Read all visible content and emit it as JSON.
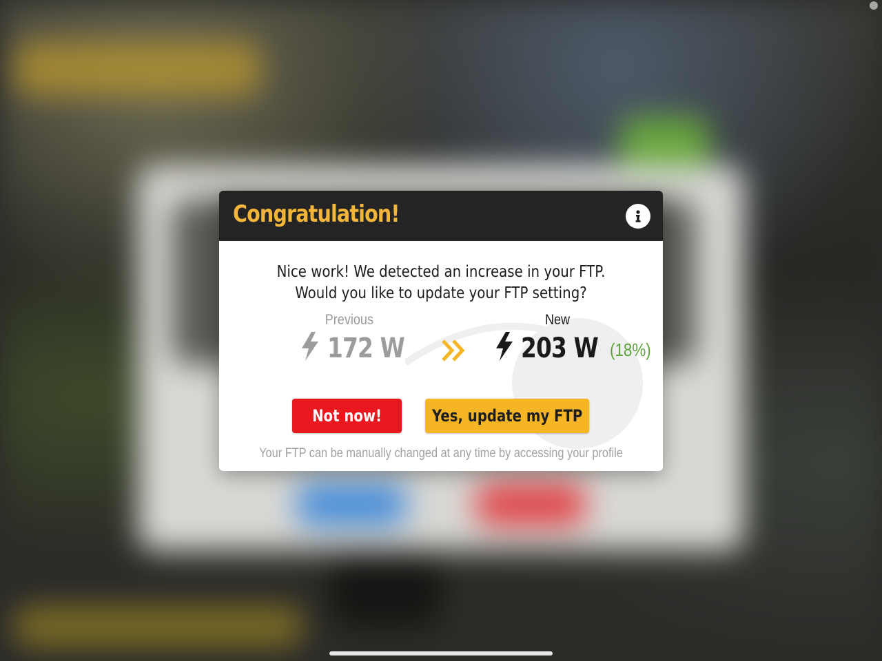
{
  "dialog": {
    "title": "Congratulation!",
    "info_icon": "info-icon",
    "message_line1": "Nice work! We detected an increase in your FTP.",
    "message_line2": "Would you like to update your FTP setting?",
    "previous": {
      "label": "Previous",
      "value": "172 W",
      "icon": "lightning-bolt-icon"
    },
    "new": {
      "label": "New",
      "value": "203 W",
      "icon": "lightning-bolt-icon",
      "change": "(18%)"
    },
    "arrow_icon": "double-chevron-right-icon",
    "buttons": {
      "not_now": "Not now!",
      "update": "Yes, update my FTP"
    },
    "footnote": "Your FTP can be manually changed at any time by accessing your profile"
  },
  "colors": {
    "header_bg": "#242424",
    "title": "#f3b63a",
    "not_now_button": "#e8181e",
    "update_button": "#f5b524",
    "percent_change": "#5da33a",
    "previous_value": "#9c9c9c"
  }
}
